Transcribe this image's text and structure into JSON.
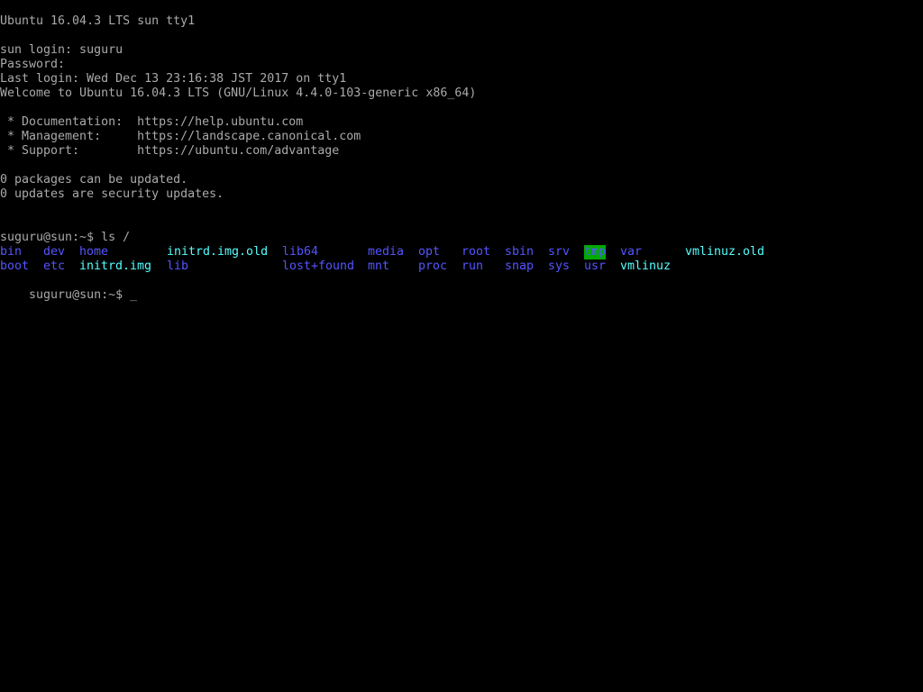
{
  "colors": {
    "background": "#000000",
    "text": "#aaaaaa",
    "directory": "#5555ff",
    "symlink": "#55ffff",
    "sticky_dir_bg": "#00aa00"
  },
  "console": {
    "banner": "Ubuntu 16.04.3 LTS sun tty1",
    "login_prompt": "sun login: suguru",
    "password_prompt": "Password:",
    "last_login": "Last login: Wed Dec 13 23:16:38 JST 2017 on tty1",
    "welcome": "Welcome to Ubuntu 16.04.3 LTS (GNU/Linux 4.4.0-103-generic x86_64)",
    "doc_line": " * Documentation:  https://help.ubuntu.com",
    "mgmt_line": " * Management:     https://landscape.canonical.com",
    "support_line": " * Support:        https://ubuntu.com/advantage",
    "packages_line": "0 packages can be updated.",
    "security_line": "0 updates are security updates.",
    "command_line": "suguru@sun:~$ ls /",
    "prompt_line": "suguru@sun:~$ ",
    "cursor_char": "_"
  },
  "ls_output": {
    "row1": [
      "bin",
      "dev",
      "home",
      "initrd.img.old",
      "lib64",
      "media",
      "opt",
      "root",
      "sbin",
      "srv",
      "tmp",
      "var",
      "vmlinuz.old"
    ],
    "row2": [
      "boot",
      "etc",
      "initrd.img",
      "lib",
      "lost+found",
      "mnt",
      "proc",
      "run",
      "snap",
      "sys",
      "usr",
      "vmlinuz"
    ]
  }
}
